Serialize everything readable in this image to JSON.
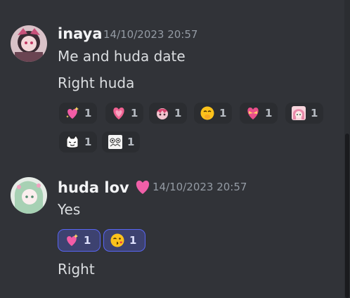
{
  "messages": [
    {
      "username": "inaya",
      "timestamp": "14/10/2023 20:57",
      "lines": [
        "Me and huda date",
        "Right huda"
      ],
      "reactions": [
        {
          "emoji": "sparkling-heart-icon",
          "count": "1",
          "active": false
        },
        {
          "emoji": "growing-heart-icon",
          "count": "1",
          "active": false
        },
        {
          "emoji": "anime-sticker-icon",
          "count": "1",
          "active": false
        },
        {
          "emoji": "hand-over-mouth-icon",
          "count": "1",
          "active": false
        },
        {
          "emoji": "heart-with-ribbon-icon",
          "count": "1",
          "active": false
        },
        {
          "emoji": "anime-girl-sticker-icon",
          "count": "1",
          "active": false
        },
        {
          "emoji": "cat-face-sticker-icon",
          "count": "1",
          "active": false
        },
        {
          "emoji": "cute-chibi-sticker-icon",
          "count": "1",
          "active": false
        }
      ]
    },
    {
      "username": "huda lov",
      "name_emoji": "pink-heart-icon",
      "timestamp": "14/10/2023 20:57",
      "lines": [
        "Yes",
        "Right"
      ],
      "reactions": [
        {
          "emoji": "sparkling-heart-icon",
          "count": "1",
          "active": true
        },
        {
          "emoji": "face-blowing-kiss-icon",
          "count": "1",
          "active": true
        }
      ]
    }
  ],
  "colors": {
    "background": "#313338",
    "active_reaction_border": "#5865f2",
    "username": "#f2f3f5",
    "timestamp": "#949ba4"
  }
}
